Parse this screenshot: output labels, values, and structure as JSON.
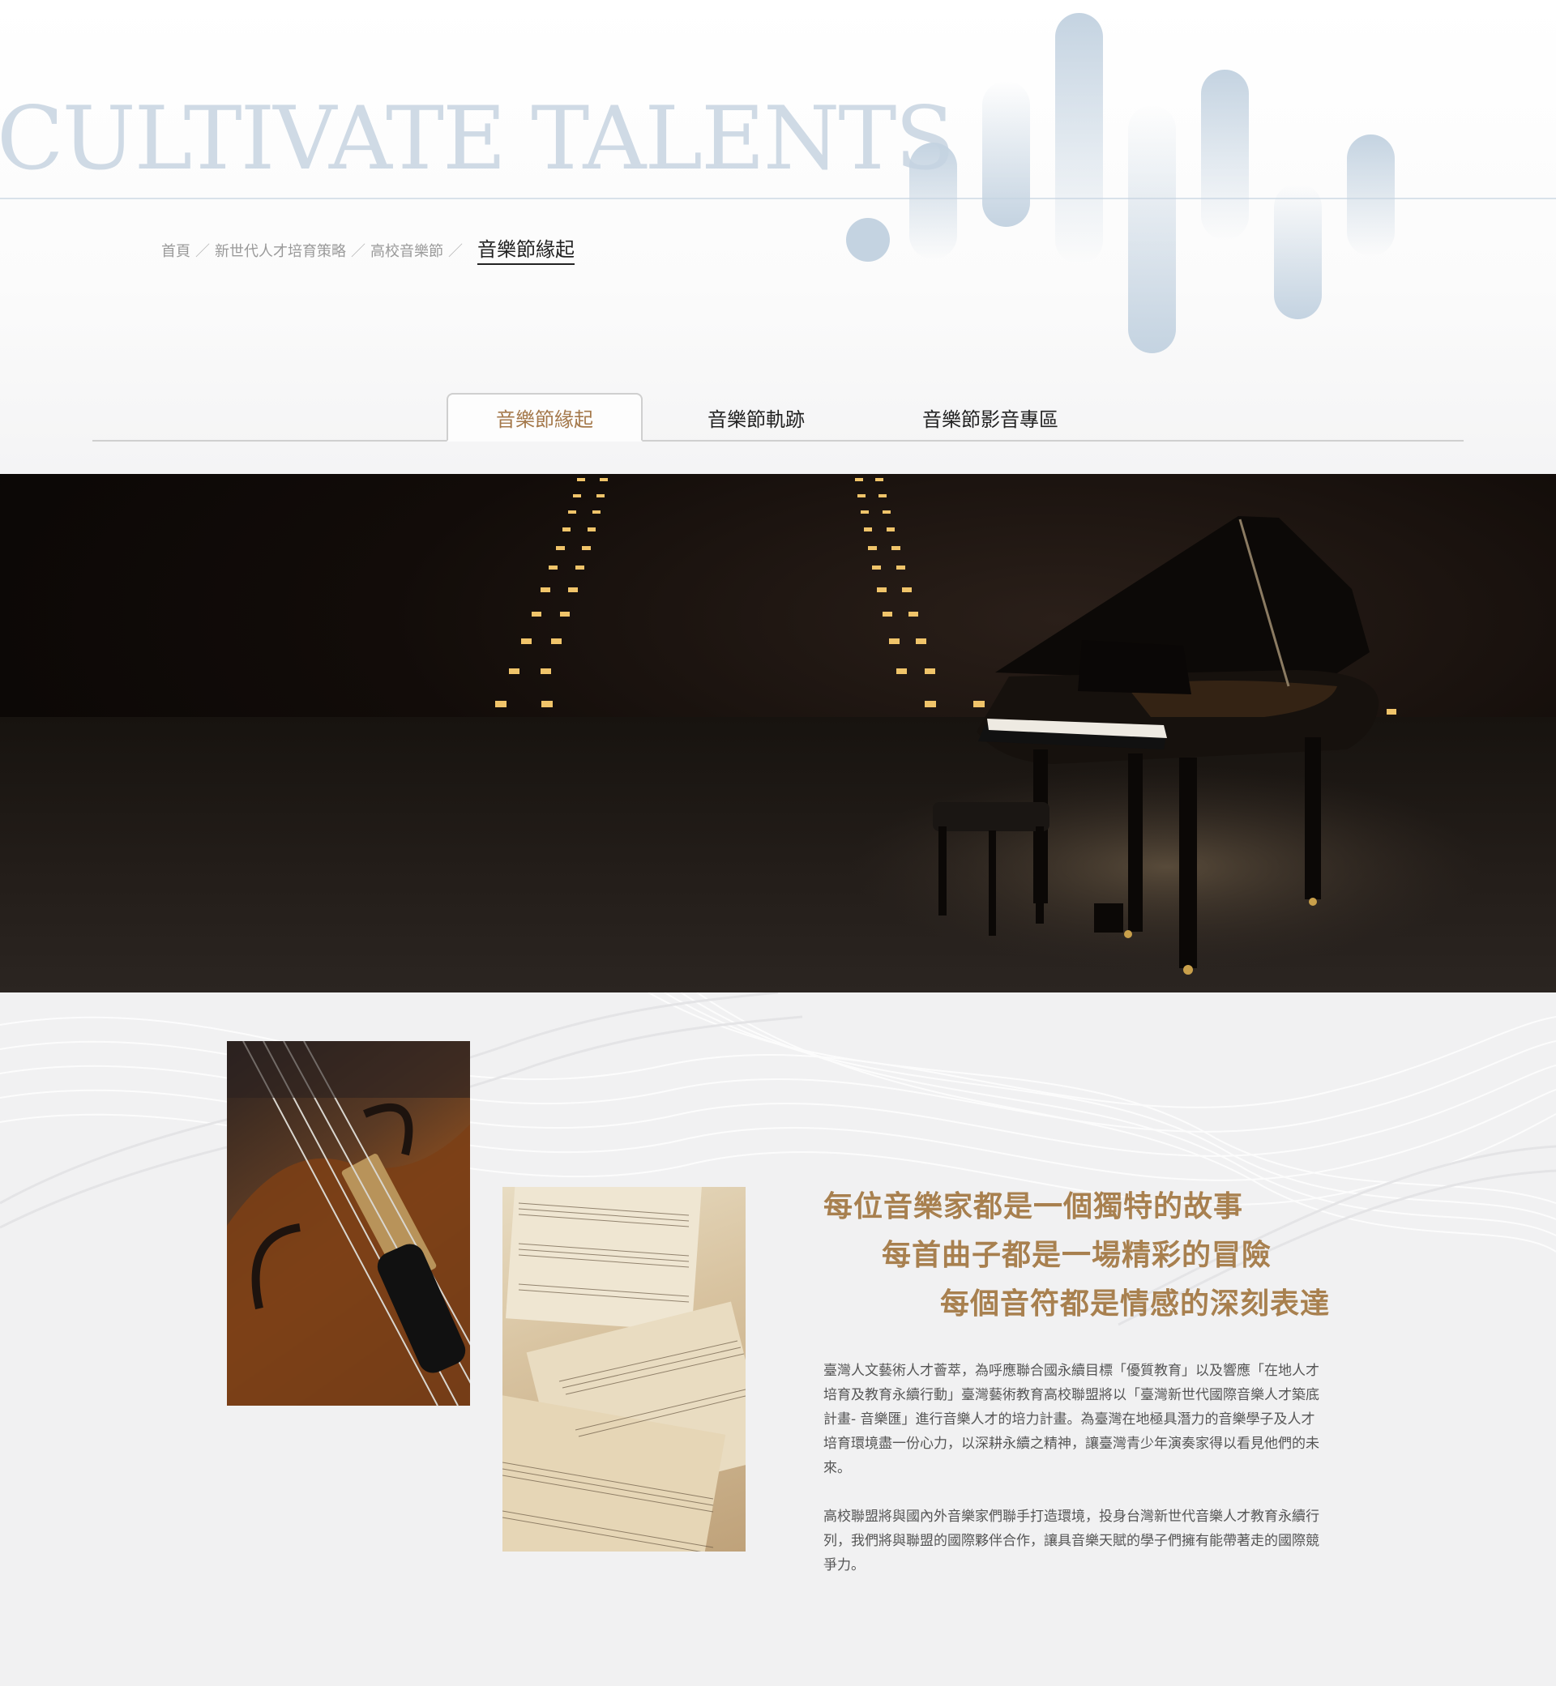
{
  "hero": {
    "title": "CULTIVATE TALENTS"
  },
  "breadcrumb": {
    "items": [
      "首頁",
      "新世代人才培育策略",
      "高校音樂節"
    ],
    "separator": "／",
    "current": "音樂節緣起"
  },
  "tabs": [
    {
      "label": "音樂節緣起",
      "active": true
    },
    {
      "label": "音樂節軌跡",
      "active": false
    },
    {
      "label": "音樂節影音專區",
      "active": false
    }
  ],
  "content": {
    "headlines": [
      "每位音樂家都是一個獨特的故事",
      "每首曲子都是一場精彩的冒險",
      "每個音符都是情感的深刻表達"
    ],
    "paragraphs": [
      "臺灣人文藝術人才薈萃，為呼應聯合國永續目標「優質教育」以及響應「在地人才培育及教育永續行動」臺灣藝術教育高校聯盟將以「臺灣新世代國際音樂人才築底計畫- 音樂匯」進行音樂人才的培力計畫。為臺灣在地極具潛力的音樂學子及人才培育環境盡一份心力，以深耕永續之精神，讓臺灣青少年演奏家得以看見他們的未來。",
      "高校聯盟將與國內外音樂家們聯手打造環境，投身台灣新世代音樂人才教育永續行列，我們將與聯盟的國際夥伴合作，讓具音樂天賦的學子們擁有能帶著走的國際競爭力。"
    ]
  },
  "colors": {
    "accent": "#a4784a",
    "headline": "#a8804f",
    "wave": "#c4d3e1",
    "title": "#cfdae5"
  }
}
